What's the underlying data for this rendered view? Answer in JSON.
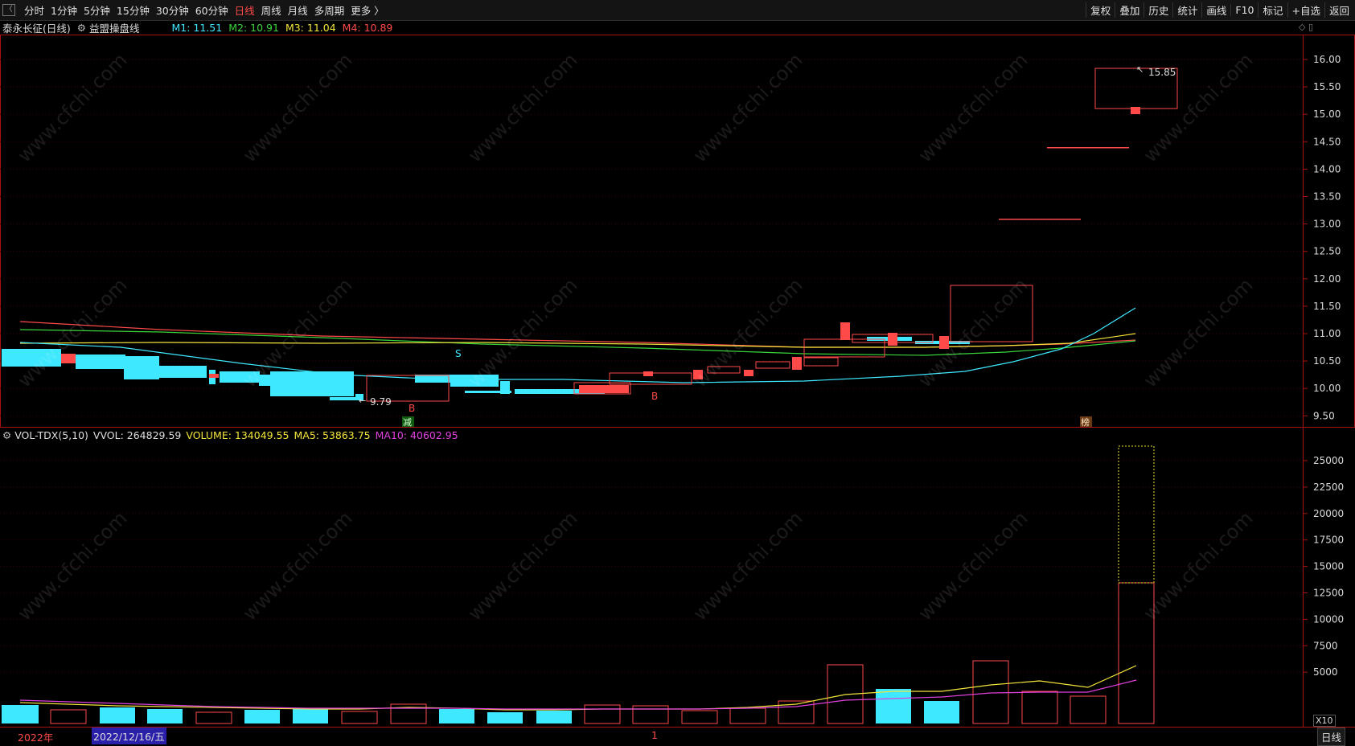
{
  "toolbar": {
    "menu_glyph": "〈",
    "periods": [
      "分时",
      "1分钟",
      "5分钟",
      "15分钟",
      "30分钟",
      "60分钟",
      "日线",
      "周线",
      "月线",
      "多周期",
      "更多 〉"
    ],
    "active_period": "日线",
    "right_buttons": [
      "复权",
      "叠加",
      "历史",
      "统计",
      "画线",
      "F10",
      "+自选",
      "返回"
    ],
    "tag_button": "标记"
  },
  "stock": {
    "name": "泰永长征(日线)",
    "indicator": "益盟操盘线",
    "m1_label": "M1: 11.51",
    "m2_label": "M2: 10.91",
    "m3_label": "M3: 11.04",
    "m4_label": "M4: 10.89",
    "colors": {
      "m1": "#3ee8ff",
      "m2": "#39d43a",
      "m3": "#f2e43a",
      "m4": "#ff4a4a"
    }
  },
  "volume_panel": {
    "title": "VOL-TDX(5,10)",
    "vvol": "VVOL: 264829.59",
    "volume": "VOLUME: 134049.55",
    "ma5": "MA5: 53863.75",
    "ma10": "MA10: 40602.95",
    "multiplier": "X10"
  },
  "price_axis": [
    "16.00",
    "15.50",
    "15.00",
    "14.50",
    "14.00",
    "13.50",
    "13.00",
    "12.50",
    "12.00",
    "11.50",
    "11.00",
    "10.50",
    "10.00",
    "9.50"
  ],
  "volume_axis": [
    "25000",
    "22500",
    "20000",
    "17500",
    "15000",
    "12500",
    "10000",
    "7500",
    "5000"
  ],
  "annotations": {
    "high_label": "15.85",
    "low_label": "9.79",
    "signal_s": "S",
    "signal_b1": "B",
    "signal_b2": "B",
    "tag_reduce": "减",
    "tag_rank": "榜"
  },
  "bottom": {
    "year": "2022年",
    "date_cursor": "2022/12/16/五",
    "month_mark": "1",
    "period_label": "日线"
  },
  "watermark": "www.cfchi.com",
  "colors": {
    "up": "#ff4a4a",
    "down": "#3ee8ff",
    "grid": "#3a0000",
    "axis": "#aa1111"
  }
}
